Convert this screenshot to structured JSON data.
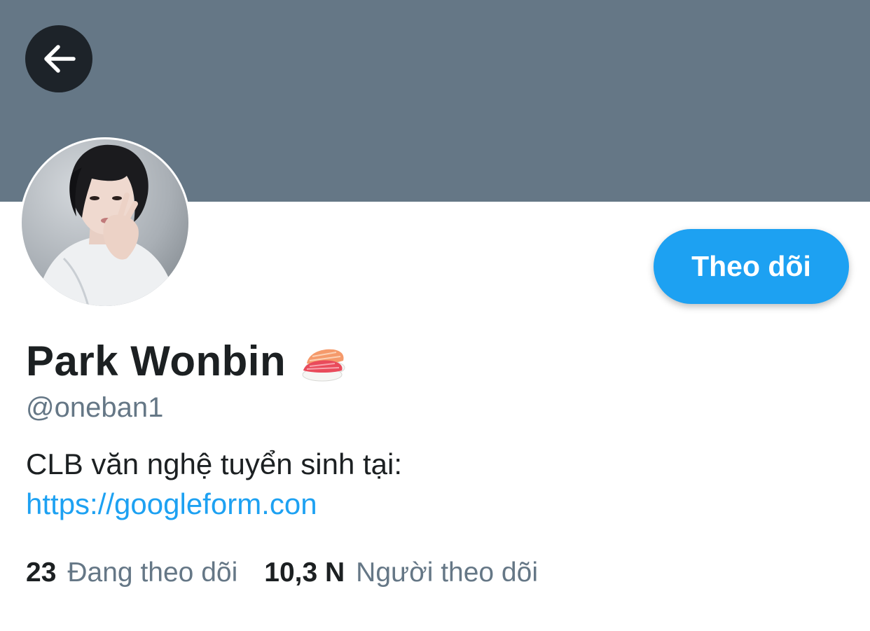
{
  "header": {
    "back_icon": "arrow-left-icon",
    "banner_color": "#657786"
  },
  "profile": {
    "display_name": "Park Wonbin",
    "name_emoji_icon": "sushi-icon",
    "handle": "@oneban1",
    "bio_text": "CLB văn nghệ tuyển sinh tại: ",
    "bio_link": "https://googleform.con",
    "avatar_icon": "profile-photo"
  },
  "actions": {
    "follow_label": "Theo dõi",
    "accent_color": "#1da1f2"
  },
  "stats": {
    "following_count": "23",
    "following_label": "Đang theo dõi",
    "followers_count": "10,3 N",
    "followers_label": "Người theo dõi"
  }
}
